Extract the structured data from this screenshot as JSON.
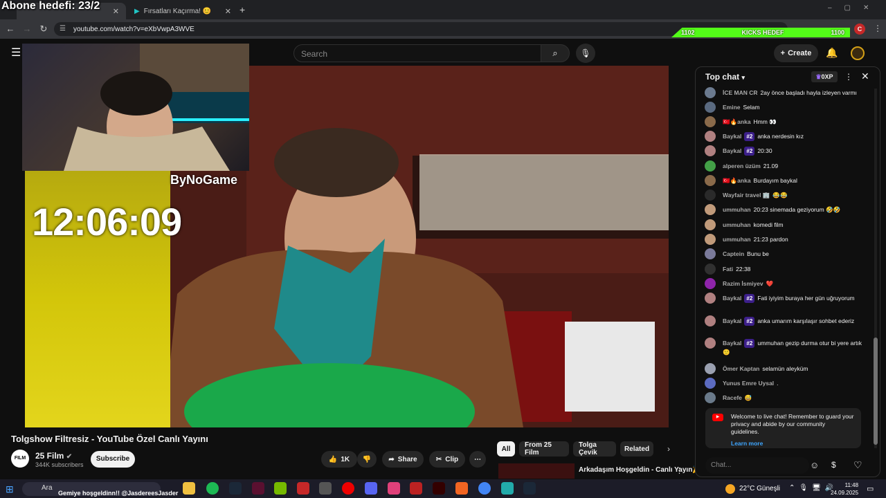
{
  "overlay": {
    "subscriber_goal": "Abone hedefi: 23/2",
    "kicks_left": "1102",
    "kicks_label": "KICKS HEDEF",
    "kicks_right": "1100",
    "kicks_progress": 1.0
  },
  "browser": {
    "tabs": [
      {
        "label": "",
        "active": true
      },
      {
        "label": "Fırsatları Kaçırma! 😊",
        "active": false
      }
    ],
    "url": "youtube.com/watch?v=eXbVwpA3WVE"
  },
  "youtube": {
    "search_placeholder": "Search",
    "create_label": "Create"
  },
  "video": {
    "timer": "12:06:09",
    "watermark": "ByNoGame",
    "title": "Tolgshow Filtresiz - YouTube Özel Canlı Yayını",
    "channel": "25 Film",
    "subscribers": "344K subscribers",
    "subscribe_label": "Subscribe",
    "likes": "1K",
    "share_label": "Share",
    "clip_label": "Clip"
  },
  "chips": [
    "All",
    "From 25 Film",
    "Tolga Çevik",
    "Related"
  ],
  "related": {
    "title": "Arkadaşım Hoşgeldin - Canlı Yayın🎉"
  },
  "chat": {
    "header": "Top chat",
    "xp_label": "0XP",
    "messages": [
      {
        "author": "İCE MAN CR",
        "badge": "",
        "text": "2ay önce başladı hayla izleyen varmı",
        "color": "#6b7a8f"
      },
      {
        "author": "Emine",
        "badge": "",
        "text": "Selam",
        "color": "#5a6a80"
      },
      {
        "author": "🇹🇷🔥anka",
        "badge": "",
        "text": "Hmm 👀",
        "color": "#8a6a4a"
      },
      {
        "author": "Baykal",
        "badge": "#2",
        "text": "anka nerdesin kız",
        "color": "#b08080"
      },
      {
        "author": "Baykal",
        "badge": "#2",
        "text": "20:30",
        "color": "#b08080"
      },
      {
        "author": "alperen üzüm",
        "badge": "",
        "text": "21.09",
        "color": "#43a047"
      },
      {
        "author": "🇹🇷🔥anka",
        "badge": "",
        "text": "Burdayım baykal",
        "color": "#8a6a4a"
      },
      {
        "author": "Wayfair travel 🏢",
        "badge": "",
        "text": "😂😂",
        "color": "#2a2a2a"
      },
      {
        "author": "ummuhan",
        "badge": "",
        "text": "20:23 sinemada geziyorum 🤣🤣",
        "color": "#c09a7a"
      },
      {
        "author": "ummuhan",
        "badge": "",
        "text": "komedi film",
        "color": "#c09a7a"
      },
      {
        "author": "ummuhan",
        "badge": "",
        "text": "21:23 pardon",
        "color": "#c09a7a"
      },
      {
        "author": "Captein",
        "badge": "",
        "text": "Bunu be",
        "color": "#7a7a9a"
      },
      {
        "author": "Fati",
        "badge": "",
        "text": "22:38",
        "color": "#303030"
      },
      {
        "author": "Razim İsmiyev",
        "badge": "",
        "text": "❤️",
        "color": "#8e24aa"
      },
      {
        "author": "Baykal",
        "badge": "#2",
        "text": "Fati iyiyim buraya her gün uğruyorum",
        "color": "#b08080"
      },
      {
        "author": "Baykal",
        "badge": "#2",
        "text": "anka umarım karşılaşır sohbet ederiz",
        "color": "#b08080"
      },
      {
        "author": "Baykal",
        "badge": "#2",
        "text": "ummuhan gezip durma otur bi yere artık 🙂",
        "color": "#b08080"
      },
      {
        "author": "Ömer Kaptan",
        "badge": "",
        "text": "selamün aleyküm",
        "color": "#9aa0b0"
      },
      {
        "author": "Yunus Emre Uysal",
        "badge": "",
        "text": ".",
        "color": "#5c6bc0"
      },
      {
        "author": "Racefe",
        "badge": "",
        "text": "😅",
        "color": "#6a7a8a"
      }
    ],
    "welcome_text": "Welcome to live chat! Remember to guard your privacy and abide by our community guidelines.",
    "learn_more": "Learn more",
    "input_placeholder": "Chat..."
  },
  "taskbar": {
    "search_label": "Ara",
    "ticker": "Gemiye hoşgeldinn!! @JasdereesJasder",
    "weather": "22°C  Güneşli",
    "time": "11:48",
    "date": "24.09.2025"
  }
}
